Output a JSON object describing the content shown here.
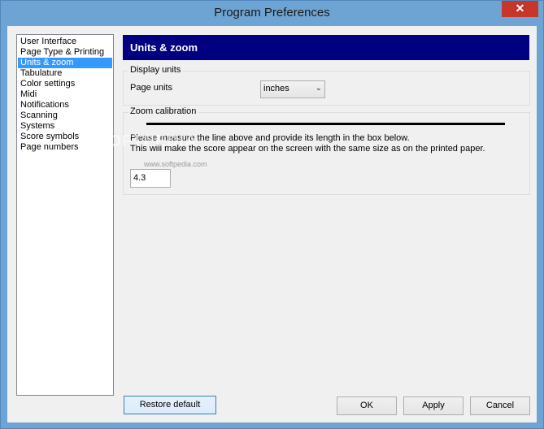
{
  "window": {
    "title": "Program Preferences",
    "close_glyph": "✕"
  },
  "nav": {
    "items": [
      {
        "label": "User Interface",
        "selected": false
      },
      {
        "label": "Page Type & Printing",
        "selected": false
      },
      {
        "label": "Units & zoom",
        "selected": true
      },
      {
        "label": "Tabulature",
        "selected": false
      },
      {
        "label": "Color settings",
        "selected": false
      },
      {
        "label": "Midi",
        "selected": false
      },
      {
        "label": "Notifications",
        "selected": false
      },
      {
        "label": "Scanning",
        "selected": false
      },
      {
        "label": "Systems",
        "selected": false
      },
      {
        "label": "Score symbols",
        "selected": false
      },
      {
        "label": "Page numbers",
        "selected": false
      }
    ]
  },
  "panel": {
    "header": "Units & zoom",
    "display_units": {
      "group_title": "Display units",
      "page_units_label": "Page units",
      "page_units_value": "inches"
    },
    "zoom": {
      "group_title": "Zoom calibration",
      "instruction_1": "Please measure the line above and provide its length in the box below.",
      "instruction_2": "This will make the score appear on the screen with the same size as on the printed paper.",
      "value": "4.3"
    }
  },
  "watermark": {
    "main": "SOFTPEDIA",
    "small": "www.softpedia.com"
  },
  "buttons": {
    "restore": "Restore default",
    "ok": "OK",
    "apply": "Apply",
    "cancel": "Cancel"
  },
  "colors": {
    "header_bg": "#000080",
    "selection": "#3399ff",
    "titlebar": "#6ea4d3",
    "close": "#c7362b"
  }
}
